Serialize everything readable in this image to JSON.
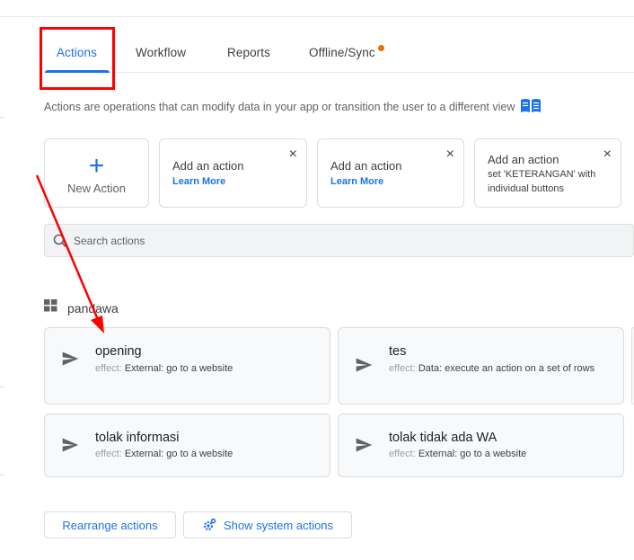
{
  "tabs": [
    {
      "label": "Actions"
    },
    {
      "label": "Workflow"
    },
    {
      "label": "Reports"
    },
    {
      "label": "Offline/Sync"
    }
  ],
  "description": "Actions are operations that can modify data in your app or transition the user to a different view",
  "new_action": {
    "icon": "+",
    "label": "New Action"
  },
  "suggestions": [
    {
      "title": "Add an action",
      "link": "Learn More",
      "close": "×"
    },
    {
      "title": "Add an action",
      "link": "Learn More",
      "close": "×"
    },
    {
      "title": "Add an action",
      "sub": "set 'KETERANGAN' with individual buttons",
      "close": "×"
    }
  ],
  "search": {
    "placeholder": "Search actions"
  },
  "group": {
    "label": "pandawa"
  },
  "actions": [
    {
      "name": "opening",
      "effect_key": "effect:",
      "effect": "External: go to a website"
    },
    {
      "name": "tes",
      "effect_key": "effect:",
      "effect": "Data: execute an action on a set of rows"
    },
    {
      "name": "tolak informasi",
      "effect_key": "effect:",
      "effect": "External: go to a website"
    },
    {
      "name": "tolak tidak ada WA",
      "effect_key": "effect:",
      "effect": "External: go to a website"
    }
  ],
  "buttons": {
    "rearrange": "Rearrange actions",
    "system": "Show system actions"
  },
  "colors": {
    "accent": "#1a73e8",
    "annotation": "#ff0000",
    "sync_dot": "#e37400"
  }
}
